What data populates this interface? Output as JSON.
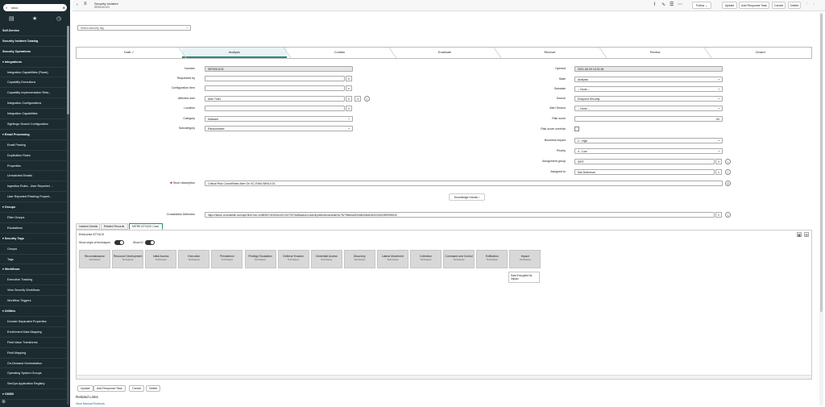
{
  "sidebar": {
    "search_value": "secu",
    "items": [
      {
        "label": "Self-Service",
        "kind": "sec"
      },
      {
        "label": "Security Incident Catalog",
        "kind": "top"
      },
      {
        "label": "Security Operations",
        "kind": "sec"
      },
      {
        "label": "Integrations",
        "kind": "grp"
      },
      {
        "label": "Integration Capabilities (Flows)",
        "kind": "item"
      },
      {
        "label": "Capability Executions",
        "kind": "item"
      },
      {
        "label": "Capability Implementation Rela...",
        "kind": "item"
      },
      {
        "label": "Integration Configurations",
        "kind": "item"
      },
      {
        "label": "Integration Capabilities",
        "kind": "item"
      },
      {
        "label": "Sightings Search Configuration",
        "kind": "item"
      },
      {
        "label": "Email Processing",
        "kind": "grp"
      },
      {
        "label": "Email Parsing",
        "kind": "item"
      },
      {
        "label": "Duplication Rules",
        "kind": "item"
      },
      {
        "label": "Properties",
        "kind": "item"
      },
      {
        "label": "Unmatched Emails",
        "kind": "item"
      },
      {
        "label": "Ingestion Rules - User Reported ...",
        "kind": "item"
      },
      {
        "label": "User Reported Phishing Propert...",
        "kind": "item"
      },
      {
        "label": "Groups",
        "kind": "grp"
      },
      {
        "label": "Filter Groups",
        "kind": "item"
      },
      {
        "label": "Escalations",
        "kind": "item"
      },
      {
        "label": "Security Tags",
        "kind": "grp"
      },
      {
        "label": "Groups",
        "kind": "item"
      },
      {
        "label": "Tags",
        "kind": "item"
      },
      {
        "label": "Workflows",
        "kind": "grp"
      },
      {
        "label": "Execution Tracking",
        "kind": "item"
      },
      {
        "label": "View Security Workflows",
        "kind": "item"
      },
      {
        "label": "Workflow Triggers",
        "kind": "item"
      },
      {
        "label": "Utilities",
        "kind": "grp"
      },
      {
        "label": "Domain Separated Properties",
        "kind": "item"
      },
      {
        "label": "Enrichment Data Mapping",
        "kind": "item"
      },
      {
        "label": "Field Value Transforms",
        "kind": "item"
      },
      {
        "label": "Field Mapping",
        "kind": "item"
      },
      {
        "label": "On-Demand Orchestration",
        "kind": "item"
      },
      {
        "label": "Operating System Groups",
        "kind": "item"
      },
      {
        "label": "SecOps Application Registry",
        "kind": "item"
      },
      {
        "label": "CMDB",
        "kind": "grp"
      }
    ]
  },
  "header": {
    "title": "Security Incident",
    "number": "SIR0010103",
    "follow": "Follow",
    "update": "Update",
    "add_response_task": "Add Response Task",
    "cancel": "Cancel",
    "delete": "Delete"
  },
  "security_tag": {
    "placeholder": "Select security tag"
  },
  "stages": [
    {
      "label": "Draft ✓",
      "active": false
    },
    {
      "label": "Analysis",
      "active": true
    },
    {
      "label": "Contain",
      "active": false
    },
    {
      "label": "Eradicate",
      "active": false
    },
    {
      "label": "Recover",
      "active": false
    },
    {
      "label": "Review",
      "active": false
    },
    {
      "label": "Closed",
      "active": false
    }
  ],
  "form_left": {
    "number_label": "Number",
    "number": "SIR0010103",
    "requested_by_label": "Requested by",
    "requested_by": "",
    "config_item_label": "Configuration item",
    "config_item": "",
    "affected_user_label": "Affected user",
    "affected_user": "Abel Tuter",
    "location_label": "Location",
    "location": "",
    "category_label": "Category",
    "category": "Malware",
    "subcategory_label": "Subcategory",
    "subcategory": "Ransomware"
  },
  "form_right": {
    "opened_label": "Opened",
    "opened": "2021-06-09 10:01:54",
    "state_label": "State",
    "state": "Analysis",
    "substate_label": "Substate",
    "substate": "-- None --",
    "source_label": "Source",
    "source": "Endpoint Security",
    "alert_sensor_label": "Alert Sensor",
    "alert_sensor": "-- None --",
    "risk_score_label": "Risk score",
    "risk_score": "64",
    "risk_override_label": "Risk score override",
    "business_impact_label": "Business impact",
    "business_impact": "2 - High",
    "priority_label": "Priority",
    "priority": "4 - Low",
    "assignment_group_label": "Assignment group",
    "assignment_group": "SIRT",
    "assigned_to_label": "Assigned to",
    "assigned_to": "Mai Determan"
  },
  "short_description_label": "Short description",
  "short_description": "Critical Risk CrowdStrike Alert On SC-RAM-WIN10-01",
  "knowledge_results": "Knowledge results",
  "crowdstrike_label": "Crowdstrike Detection",
  "crowdstrike_url": "https://falcon.crowdstrike.com/api2/link?cid=1d4fb96074e0446c10c7d070574a38aa&url=/activity/detections/detail/3c79c796fdea4940b8c50dd63e2e3426/2859594626",
  "tabs": [
    {
      "label": "Incident Details",
      "active": false
    },
    {
      "label": "Related Records",
      "active": false
    },
    {
      "label": "MITRE ATT&CK Card",
      "active": true
    }
  ],
  "mitre": {
    "matrix": "Enterprise ATT&CK",
    "show_origin_label": "Show origin of techniques",
    "show_id_label": "Show ID",
    "tactic_sub": "Techniques",
    "tactics": [
      "Reconnaissance",
      "Resource Development",
      "Initial Access",
      "Execution",
      "Persistence",
      "Privilege Escalation",
      "Defense Evasion",
      "Credential Access",
      "Discovery",
      "Lateral Movement",
      "Collection",
      "Command and Control",
      "Exfiltration",
      "Impact"
    ],
    "impact_technique": "Data Encrypted for Impact"
  },
  "bottom_buttons": {
    "update": "Update",
    "add_response_task": "Add Response Task",
    "cancel": "Cancel",
    "delete": "Delete"
  },
  "related_links": {
    "title": "Related Links",
    "view_manual_runbook": "View Manual Runbook"
  }
}
